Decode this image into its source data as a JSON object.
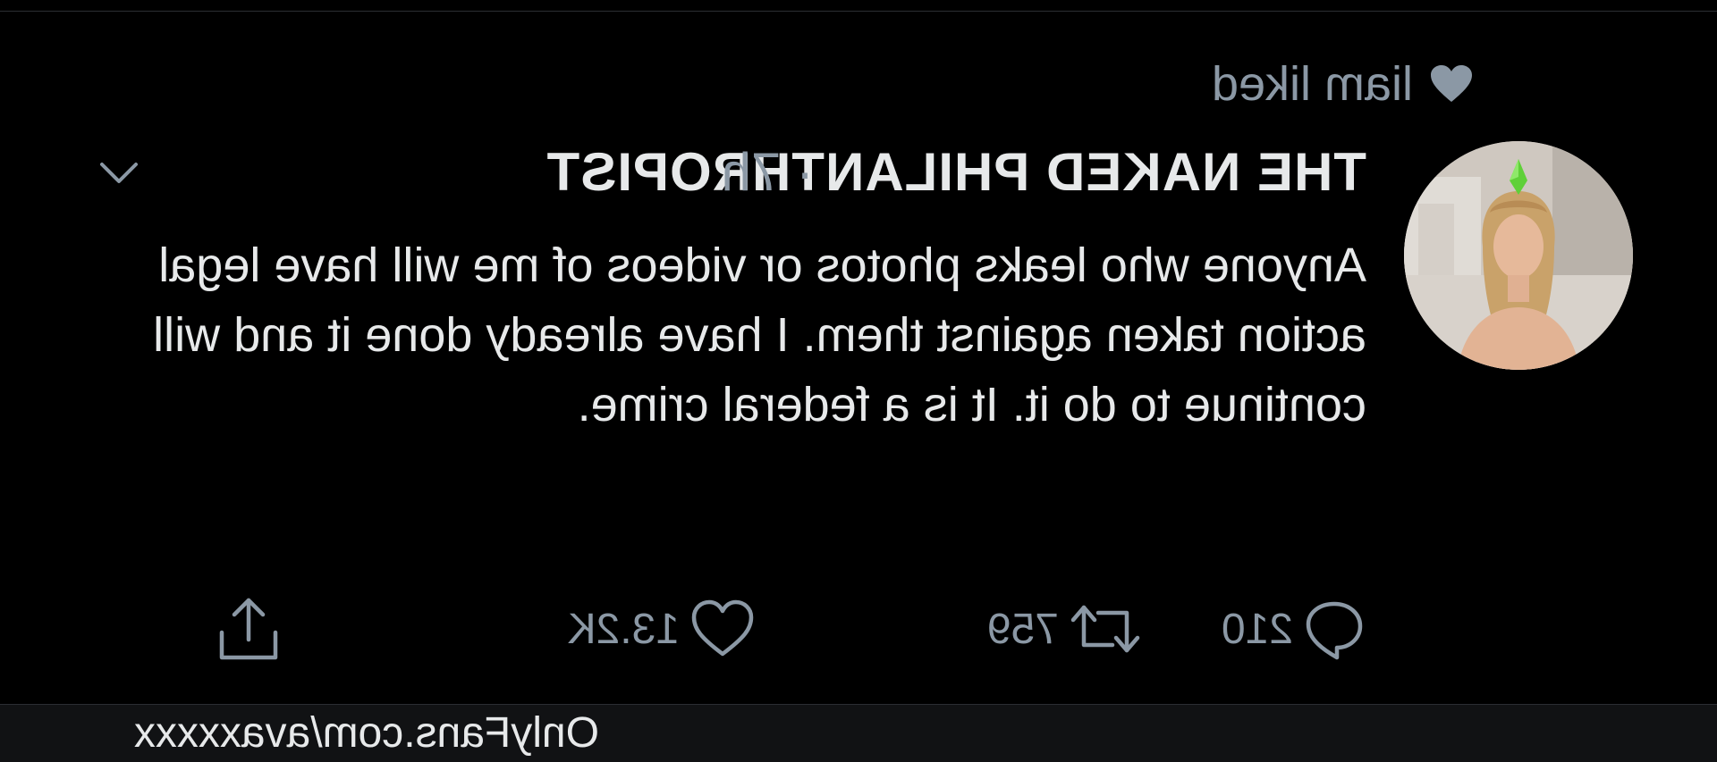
{
  "social_context": {
    "text": "liam liked",
    "icon": "heart-icon"
  },
  "tweet": {
    "display_name": "THE NAKED PHILANTHROPIST",
    "separator_time": "· 7h",
    "text": "Anyone who leaks photos or videos of me will have legal action taken against them. I have already done it and will continue to do it. It is a federal crime.",
    "actions": {
      "reply_count": "210",
      "retweet_count": "759",
      "like_count": "13.2K"
    },
    "icons": {
      "reply": "comment-icon",
      "retweet": "retweet-icon",
      "like": "heart-outline-icon",
      "share": "share-icon",
      "more": "chevron-down-icon"
    }
  },
  "watermark": {
    "text": "OnlyFans.com/avaxxxxx"
  },
  "colors": {
    "background": "#000000",
    "primary_text": "#e7e9ea",
    "secondary_text": "#8b98a5",
    "bottom_bar": "#111214"
  }
}
